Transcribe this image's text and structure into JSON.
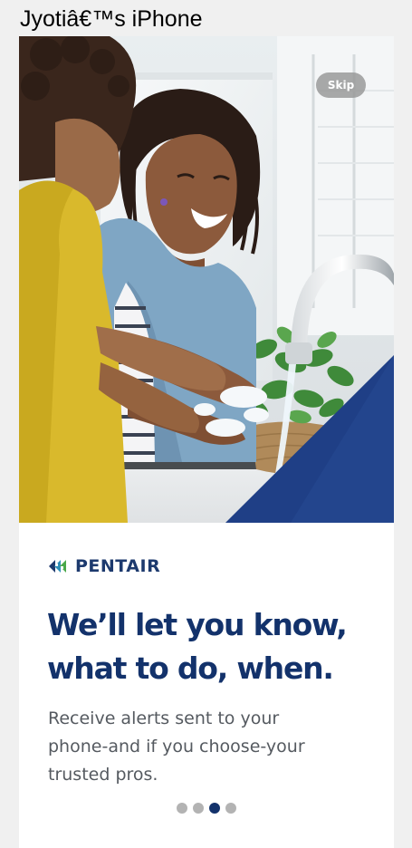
{
  "window": {
    "title": "Jyotiâ€™s iPhone"
  },
  "hero": {
    "image_icon": "photo-mother-child-washing-hands",
    "skip_label": "Skip"
  },
  "brand": {
    "logo_icon": "pentair-logo-icon",
    "name": "PENTAIR",
    "color": "#1d3a6e"
  },
  "content": {
    "headline_line1": "We’ll let you know,",
    "headline_line2": "what to do, when.",
    "body_line1": "Receive alerts sent to your",
    "body_line2": "phone-and if you choose-your",
    "body_line3": "trusted pros."
  },
  "pager": {
    "total": 4,
    "active_index": 2
  },
  "colors": {
    "accent": "#13326b",
    "body_text": "#555a60",
    "dot_inactive": "#b3b3b3"
  }
}
